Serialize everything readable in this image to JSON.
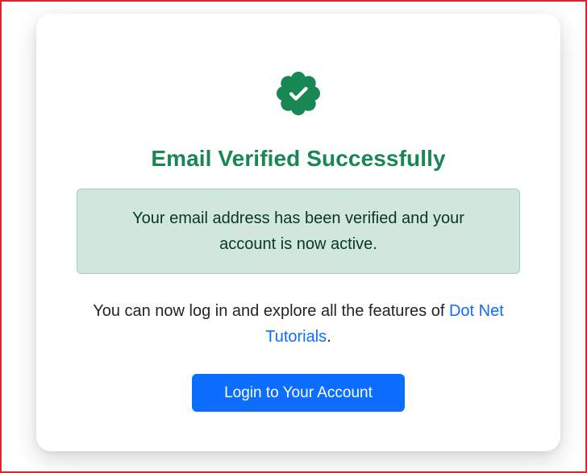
{
  "colors": {
    "success": "#198754",
    "alert_bg": "#d1e7dd",
    "alert_border": "#a3cfbb",
    "alert_text": "#0a3622",
    "link": "#0d6efd",
    "button_bg": "#0d6efd",
    "frame_border": "#d9262e"
  },
  "card": {
    "icon": "check-badge-icon",
    "title": "Email Verified Successfully",
    "alert": {
      "message": "Your email address has been verified and your account is now active."
    },
    "info": {
      "text_before": "You can now log in and explore all the features of ",
      "link_label": "Dot Net Tutorials",
      "text_after": "."
    },
    "login_button_label": "Login to Your Account"
  }
}
